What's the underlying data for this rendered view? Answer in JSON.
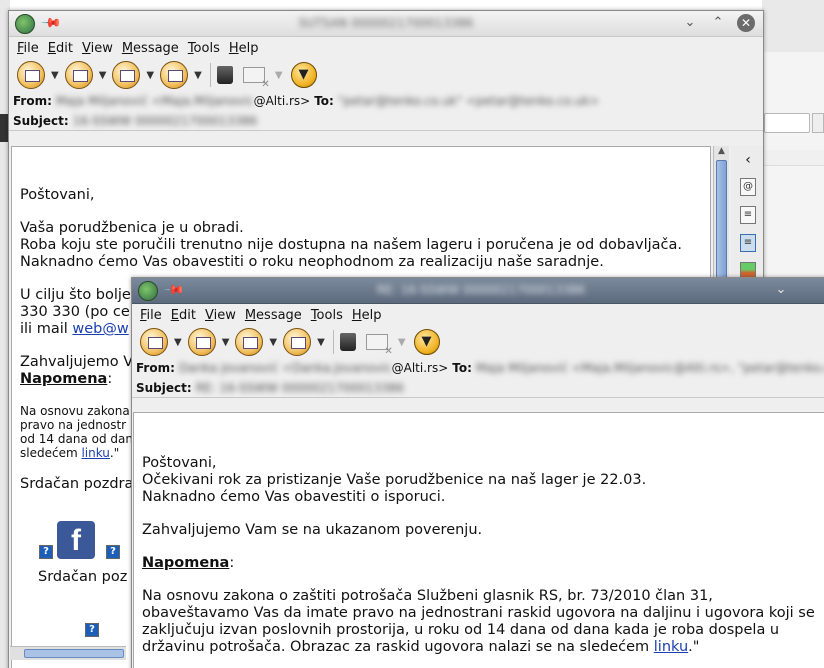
{
  "window1": {
    "title": "SUTSAN 0000021700013386",
    "menu": [
      "File",
      "Edit",
      "View",
      "Message",
      "Tools",
      "Help"
    ],
    "from_label": "From:",
    "from_blurred": "Maja Miljanović <Maja.Miljanovic",
    "from_domain": "@Alti.rs>",
    "to_label": "To:",
    "to_blurred": "\"petar@tenko.co.uk\" <petar@tenko.co.uk>",
    "subject_label": "Subject:",
    "subject_blurred": "16-SSWW 0000021700013386",
    "body": {
      "greeting": "Poštovani,",
      "line1": "Vaša porudžbenica je u obradi.",
      "line2": "Roba koju ste poručili trenutno nije dostupna na našem lageru i poručena je od dobavljača.",
      "line3": "Naknadno ćemo Vas obavestiti o roku neophodnom za realizaciju naše saradnje.",
      "para2_l1": "U cilju što bolje",
      "para2_l2": "330 330 (po ce",
      "para2_l3_prefix": "ili mail ",
      "para2_l3_link": "web@w",
      "thanks": "Zahvaljujemo V",
      "note_label": "Napomena",
      "note_colon": ":",
      "small_l1": "Na osnovu zakona",
      "small_l2": "pravo na jednostr",
      "small_l3": "od 14 dana od dan",
      "small_l4_prefix": "sledećem ",
      "small_l4_link": "linku",
      "small_l4_suffix": ".\"",
      "regards": "Srdačan pozdra",
      "regards2": "Srdačan poz"
    }
  },
  "window2": {
    "title": "RE: 16-SSWW 0000021700013386",
    "menu": [
      "File",
      "Edit",
      "View",
      "Message",
      "Tools",
      "Help"
    ],
    "from_label": "From:",
    "from_blurred": "Danka Jovanović <Danka.Jovanovic",
    "from_domain": "@Alti.rs>",
    "to_label": "To:",
    "to_blurred": "Maja Miljanović <Maja.Miljanovic@Alti.rs>, \"petar@tenko.co.uk\"",
    "subject_label": "Subject:",
    "subject_blurred": "RE: 16-SSWW 0000021700013386",
    "body": {
      "greeting": "Poštovani,",
      "line1": "Očekivani rok za pristizanje Vaše porudžbenice na naš lager je 22.03.",
      "line2": "Naknadno ćemo Vas obavestiti o isporuci.",
      "thanks": "Zahvaljujemo Vam se na ukazanom poverenju.",
      "note_label": "Napomena",
      "note_colon": ":",
      "legal_l1": "Na osnovu zakona o zaštiti potrošača Službeni glasnik RS, br. 73/2010 član 31,",
      "legal_l2": "obaveštavamo Vas da imate pravo na jednostrani raskid ugovora na daljinu i ugovora koji se",
      "legal_l3": "zaključuju izvan poslovnih prostorija, u roku od 14 dana od dana kada je roba dospela u",
      "legal_l4_prefix": "državinu potrošača. Obrazac za raskid ugovora nalazi se na sledećem ",
      "legal_l4_link": "linku",
      "legal_l4_suffix": ".\""
    }
  },
  "icons": {
    "facebook": "f",
    "missing_image": "?",
    "stop": "▼",
    "chevron_left": "‹"
  }
}
